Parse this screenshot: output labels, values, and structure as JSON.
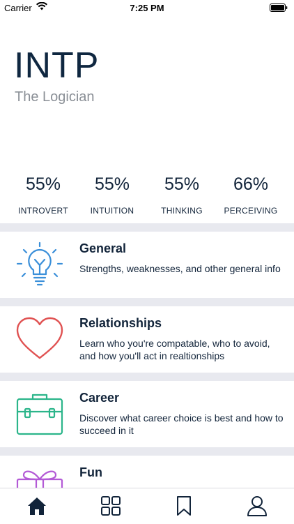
{
  "status_bar": {
    "carrier": "Carrier",
    "time": "7:25 PM"
  },
  "profile": {
    "type_code": "INTP",
    "type_name": "The Logician"
  },
  "stats": [
    {
      "value": "55%",
      "label": "INTROVERT"
    },
    {
      "value": "55%",
      "label": "INTUITION"
    },
    {
      "value": "55%",
      "label": "THINKING"
    },
    {
      "value": "66%",
      "label": "PERCEIVING"
    }
  ],
  "cards": [
    {
      "title": "General",
      "description": "Strengths, weaknesses, and other general info",
      "icon": "lightbulb-icon",
      "color": "#3a8fd9"
    },
    {
      "title": "Relationships",
      "description": "Learn who you're compatable, who to avoid, and how you'll act in realtionships",
      "icon": "heart-icon",
      "color": "#e05252"
    },
    {
      "title": "Career",
      "description": "Discover what career choice is best and how to succeed in it",
      "icon": "briefcase-icon",
      "color": "#2bb58a"
    },
    {
      "title": "Fun",
      "description": "",
      "icon": "gift-icon",
      "color": "#b35ad6"
    }
  ],
  "tab_bar": {
    "tabs": [
      "home-icon",
      "grid-icon",
      "bookmark-icon",
      "profile-icon"
    ],
    "active": "home-icon",
    "active_color": "#12243a"
  }
}
